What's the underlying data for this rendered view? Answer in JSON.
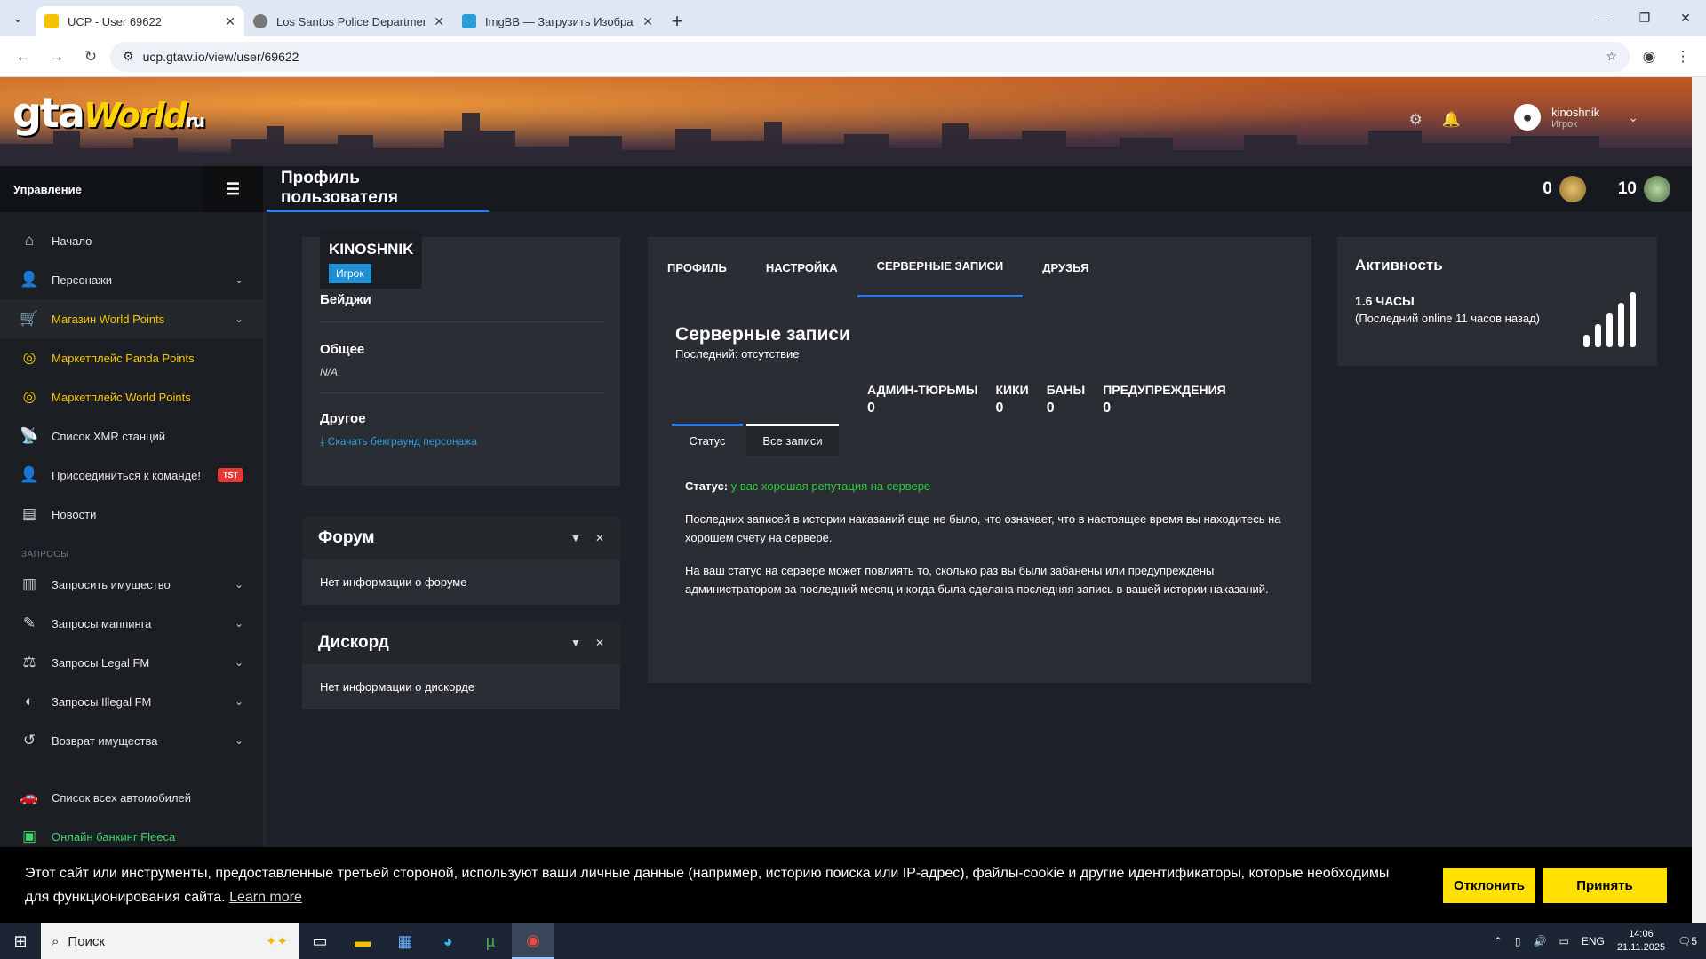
{
  "browser": {
    "tabs": [
      {
        "title": "UCP - User 69622",
        "active": true,
        "favicon_color": "#f5c400"
      },
      {
        "title": "Los Santos Police Department -",
        "active": false,
        "favicon_color": "#777777"
      },
      {
        "title": "ImgBB — Загрузить Изображе",
        "active": false,
        "favicon_color": "#2d9cdb"
      }
    ],
    "url": "ucp.gtaw.io/view/user/69622"
  },
  "header": {
    "logo_main": "gta",
    "logo_world": "World",
    "logo_ru": "ru",
    "user_name": "kinoshnik",
    "user_role": "Игрок"
  },
  "titlebar": {
    "sidebar_label": "Управление",
    "page_title": "Профиль пользователя",
    "points_a": "0",
    "points_b": "10"
  },
  "sidebar": {
    "items": [
      {
        "label": "Начало",
        "icon": "home-icon"
      },
      {
        "label": "Персонажи",
        "icon": "user-icon"
      },
      {
        "label": "Магазин World Points",
        "icon": "cart-icon"
      },
      {
        "label": "Маркетплейс Panda Points",
        "icon": "coins-icon"
      },
      {
        "label": "Маркетплейс World Points",
        "icon": "coins-icon"
      },
      {
        "label": "Список XMR станций",
        "icon": "antenna-icon"
      },
      {
        "label": "Присоединиться к команде!",
        "icon": "user-plus-icon",
        "badge": "TST"
      },
      {
        "label": "Новости",
        "icon": "news-icon"
      }
    ],
    "section_label": "ЗАПРОСЫ",
    "items2": [
      {
        "label": "Запросить имущество",
        "icon": "building-icon"
      },
      {
        "label": "Запросы маппинга",
        "icon": "brush-icon"
      },
      {
        "label": "Запросы Legal FM",
        "icon": "scales-icon"
      },
      {
        "label": "Запросы Illegal FM",
        "icon": "mask-icon"
      },
      {
        "label": "Возврат имущества",
        "icon": "undo-icon"
      }
    ],
    "items3": [
      {
        "label": "Список всех автомобилей",
        "icon": "car-icon"
      },
      {
        "label": "Онлайн банкинг Fleeca",
        "icon": "bank-icon"
      }
    ]
  },
  "profile": {
    "name": "KINOSHNIK",
    "role": "Игрок",
    "badges_title": "Бейджи",
    "general_title": "Общее",
    "general_value": "N/A",
    "other_title": "Другое",
    "download_link": "Скачать бекграунд персонажа"
  },
  "forum": {
    "title": "Форум",
    "body": "Нет информации о форуме"
  },
  "discord": {
    "title": "Дискорд",
    "body": "Нет информации о дискорде"
  },
  "records": {
    "tabs": [
      "ПРОФИЛЬ",
      "НАСТРОЙКА",
      "СЕРВЕРНЫЕ ЗАПИСИ",
      "ДРУЗЬЯ"
    ],
    "active_tab": 2,
    "heading": "Серверные записи",
    "last": "Последний: отсутствие",
    "stats": [
      {
        "label": "АДМИН-ТЮРЬМЫ",
        "value": "0"
      },
      {
        "label": "КИКИ",
        "value": "0"
      },
      {
        "label": "БАНЫ",
        "value": "0"
      },
      {
        "label": "ПРЕДУПРЕЖДЕНИЯ",
        "value": "0"
      }
    ],
    "subtabs": [
      "Статус",
      "Все записи"
    ],
    "status_label": "Статус:",
    "status_value": "у вас хорошая репутация на сервере",
    "para1": "Последних записей в истории наказаний еще не было, что означает, что в настоящее время вы находитесь на хорошем счету на сервере.",
    "para2": "На ваш статус на сервере может повлиять то, сколько раз вы были забанены или предупреждены администратором за последний месяц и когда была сделана последняя запись в вашей истории наказаний."
  },
  "activity": {
    "title": "Активность",
    "hours": "1.6 ЧАСЫ",
    "last_online": "(Последний online 11 часов назад)"
  },
  "cookie": {
    "text": "Этот сайт или инструменты, предоставленные третьей стороной, используют ваши личные данные (например, историю поиска или IP-адрес), файлы-cookie и другие идентификаторы, которые необходимы для функционирования сайта.",
    "learn_more": "Learn more",
    "decline": "Отклонить",
    "accept": "Принять"
  },
  "taskbar": {
    "search_placeholder": "Поиск",
    "lang": "ENG",
    "time": "14:06",
    "date": "21.11.2025",
    "notif_count": "5"
  },
  "colors": {
    "accent": "#2c7be5",
    "gold": "#f5c400",
    "green": "#3ed36b",
    "status_green": "#2ecc40",
    "cookie_button": "#ffe000"
  }
}
